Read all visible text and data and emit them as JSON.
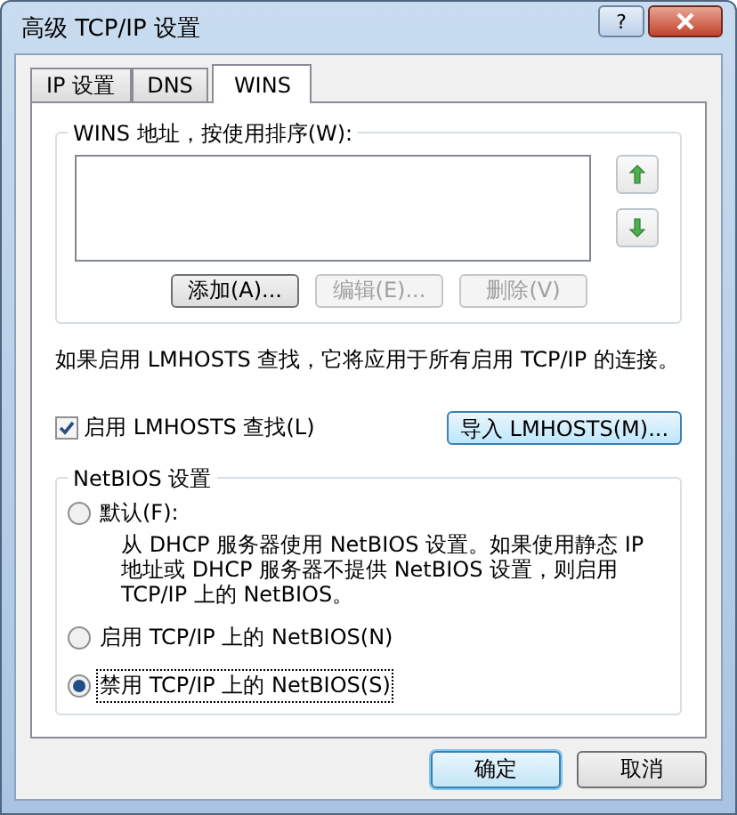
{
  "window": {
    "title": "高级 TCP/IP 设置",
    "help_label": "?"
  },
  "tabs": [
    {
      "label": "IP 设置",
      "selected": false
    },
    {
      "label": "DNS",
      "selected": false
    },
    {
      "label": "WINS",
      "selected": true
    }
  ],
  "wins_group": {
    "label": "WINS 地址，按使用排序(W):",
    "buttons": [
      {
        "label": "添加(A)...",
        "disabled": false
      },
      {
        "label": "编辑(E)...",
        "disabled": true
      },
      {
        "label": "删除(V)",
        "disabled": true
      }
    ]
  },
  "note": "如果启用 LMHOSTS 查找，它将应用于所有启用 TCP/IP 的连接。",
  "lmhosts_checkbox": {
    "label": "启用 LMHOSTS 查找(L)",
    "checked": true
  },
  "import_button": "导入 LMHOSTS(M)...",
  "netbios_group": {
    "label": "NetBIOS 设置",
    "options": [
      {
        "label": "默认(F):",
        "selected": false,
        "description": "从 DHCP 服务器使用 NetBIOS 设置。如果使用静态 IP 地址或 DHCP 服务器不提供 NetBIOS 设置，则启用 TCP/IP 上的 NetBIOS。"
      },
      {
        "label": "启用 TCP/IP 上的 NetBIOS(N)",
        "selected": false
      },
      {
        "label": "禁用 TCP/IP 上的 NetBIOS(S)",
        "selected": true
      }
    ]
  },
  "dialog_buttons": [
    {
      "label": "确定",
      "default": true
    },
    {
      "label": "取消",
      "default": false
    }
  ]
}
